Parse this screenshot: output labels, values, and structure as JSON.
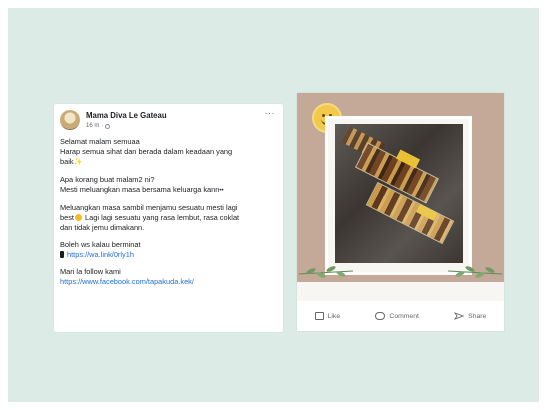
{
  "post": {
    "author": "Mama Diva Le Gateau",
    "time": "16 m",
    "more": "···",
    "lines": [
      "Selamat malam semuaa",
      "Harap semua sihat dan berada dalam keadaan yang",
      "baik",
      "Apa korang buat malam2 ni?",
      "Mesti meluangkan masa bersama keluarga kann",
      "Meluangkan masa sambil menjamu sesuatu mesti lagi",
      "best",
      "Lagi lagi sesuatu yang rasa lembut, rasa coklat",
      "dan tidak jemu dimakann.",
      "Boleh ws kalau berminat",
      "https://wa.link/0rly1h",
      "Mari la follow kami",
      "https://www.facebook.com/tapakuda.kek/"
    ]
  },
  "actions": {
    "like": "Like",
    "comment": "Comment",
    "share": "Share"
  },
  "icons": [
    "globe-icon",
    "more-icon",
    "phone-icon",
    "sparkle-icon",
    "smiley-icon",
    "like-icon",
    "comment-icon",
    "share-icon"
  ],
  "colors": {
    "background": "#dcebe5",
    "link": "#216fdb",
    "image_bg": "#c4a998"
  }
}
